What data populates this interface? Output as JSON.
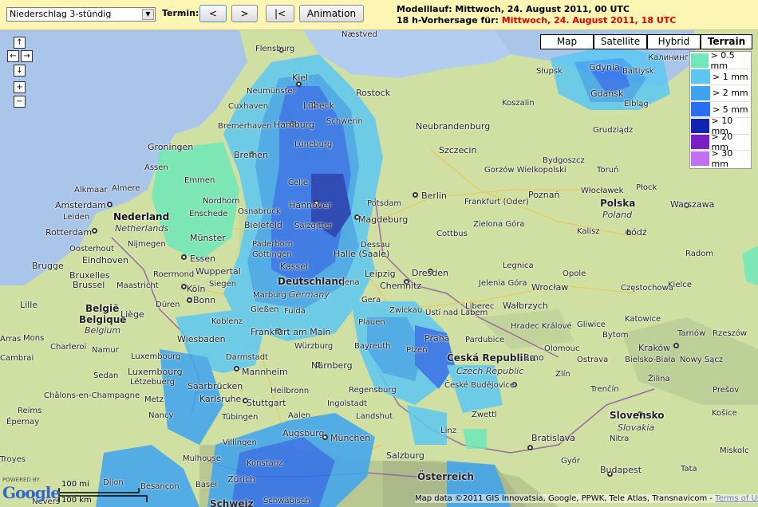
{
  "toolbar": {
    "product_selected": "Niederschlag 3-stündig",
    "termin_label": "Termin:",
    "prev_label": "<",
    "next_label": ">",
    "first_label": "|<",
    "animation_label": "Animation"
  },
  "header": {
    "model_run": "Modelllauf: Mittwoch, 24. August 2011, 00 UTC",
    "forecast_prefix": "18 h-Vorhersage für: ",
    "forecast_time": "Mittwoch, 24. August 2011, 18 UTC",
    "forecast_color": "#e00000"
  },
  "map_types": [
    {
      "label": "Map",
      "active": false
    },
    {
      "label": "Satellite",
      "active": false
    },
    {
      "label": "Hybrid",
      "active": false
    },
    {
      "label": "Terrain",
      "active": true
    }
  ],
  "nav": {
    "up": "↑",
    "left": "←",
    "right": "→",
    "down": "↓",
    "zoom_in": "+",
    "zoom_out": "−"
  },
  "legend": [
    {
      "label": "> 0.5 mm",
      "color": "#6ee8b8"
    },
    {
      "label": "> 1 mm",
      "color": "#5cc8f2"
    },
    {
      "label": "> 2 mm",
      "color": "#3ea4f0"
    },
    {
      "label": "> 5 mm",
      "color": "#2a6ef0"
    },
    {
      "label": "> 10 mm",
      "color": "#0f24b0"
    },
    {
      "label": "> 20 mm",
      "color": "#7a1ec8"
    },
    {
      "label": "> 30 mm",
      "color": "#c070f0"
    }
  ],
  "scale": {
    "miles": "100 mi",
    "km": "100 km"
  },
  "google": {
    "powered": "POWERED BY",
    "logo": "Google"
  },
  "attribution": {
    "text": "Map data ©2011 GIS Innovatsia, Google, PPWK, Tele Atlas, Transnavicom - ",
    "terms": "Terms of Use"
  },
  "places": [
    {
      "name": "Flensburg"
    },
    {
      "name": "Næstved"
    },
    {
      "name": "Kiel"
    },
    {
      "name": "Neumünster"
    },
    {
      "name": "Rostock"
    },
    {
      "name": "Lübeck"
    },
    {
      "name": "Cuxhaven"
    },
    {
      "name": "Hamburg"
    },
    {
      "name": "Schwerin"
    },
    {
      "name": "Bremerhaven"
    },
    {
      "name": "Neubrandenburg"
    },
    {
      "name": "Szczecin"
    },
    {
      "name": "Groningen"
    },
    {
      "name": "Lüneburg"
    },
    {
      "name": "Bremen"
    },
    {
      "name": "Assen"
    },
    {
      "name": "Emmen"
    },
    {
      "name": "Celle"
    },
    {
      "name": "Alkmaar"
    },
    {
      "name": "Almere"
    },
    {
      "name": "Amsterdam"
    },
    {
      "name": "Hannover"
    },
    {
      "name": "Potsdam"
    },
    {
      "name": "Berlin"
    },
    {
      "name": "Frankfurt (Oder)"
    },
    {
      "name": "Poznań"
    },
    {
      "name": "Leiden"
    },
    {
      "name": "Nederland"
    },
    {
      "name": "Netherlands"
    },
    {
      "name": "Nordhorn"
    },
    {
      "name": "Enschede"
    },
    {
      "name": "Osnabrück"
    },
    {
      "name": "Magdeburg"
    },
    {
      "name": "Zielona Góra"
    },
    {
      "name": "Rotterdam"
    },
    {
      "name": "Bielefeld"
    },
    {
      "name": "Salzgitter"
    },
    {
      "name": "Dessau"
    },
    {
      "name": "Cottbus"
    },
    {
      "name": "Nijmegen"
    },
    {
      "name": "Münster"
    },
    {
      "name": "Paderborn"
    },
    {
      "name": "Oosterhout"
    },
    {
      "name": "Göttingen"
    },
    {
      "name": "Halle (Saale)"
    },
    {
      "name": "Eindhoven"
    },
    {
      "name": "Essen"
    },
    {
      "name": "Kassel"
    },
    {
      "name": "Leipzig"
    },
    {
      "name": "Dresden"
    },
    {
      "name": "Legnica"
    },
    {
      "name": "Wrocław"
    },
    {
      "name": "Brugge"
    },
    {
      "name": "Bruxelles"
    },
    {
      "name": "Roermond"
    },
    {
      "name": "Wuppertal"
    },
    {
      "name": "Deutschland"
    },
    {
      "name": "Jena"
    },
    {
      "name": "Chemnitz"
    },
    {
      "name": "Jelenia Góra"
    },
    {
      "name": "Brussel"
    },
    {
      "name": "Maastricht"
    },
    {
      "name": "Köln"
    },
    {
      "name": "Siegen"
    },
    {
      "name": "Germany"
    },
    {
      "name": "Gera"
    },
    {
      "name": "Lille"
    },
    {
      "name": "België"
    },
    {
      "name": "Belgique"
    },
    {
      "name": "Belgium"
    },
    {
      "name": "Liège"
    },
    {
      "name": "Bonn"
    },
    {
      "name": "Marburg"
    },
    {
      "name": "Gießen"
    },
    {
      "name": "Fulda"
    },
    {
      "name": "Zwickau"
    },
    {
      "name": "Liberec"
    },
    {
      "name": "Wałbrzych"
    },
    {
      "name": "Düren"
    },
    {
      "name": "Ústí nad Labem"
    },
    {
      "name": "Koblenz"
    },
    {
      "name": "Plauen"
    },
    {
      "name": "Hradec Králové"
    },
    {
      "name": "Pardubice"
    },
    {
      "name": "Frankfurt am Main"
    },
    {
      "name": "Wiesbaden"
    },
    {
      "name": "Würzburg"
    },
    {
      "name": "Bayreuth"
    },
    {
      "name": "Plzeň"
    },
    {
      "name": "Praha"
    },
    {
      "name": "Luxembourg"
    },
    {
      "name": "Darmstadt"
    },
    {
      "name": "Mannheim"
    },
    {
      "name": "Nürnberg"
    },
    {
      "name": "Česká Republika"
    },
    {
      "name": "Czech Republic"
    },
    {
      "name": "Brno"
    },
    {
      "name": "Luxembourg"
    },
    {
      "name": "Lëtzebuerg"
    },
    {
      "name": "Saarbrücken"
    },
    {
      "name": "Heilbronn"
    },
    {
      "name": "Regensburg"
    },
    {
      "name": "České Budějovice"
    },
    {
      "name": "Metz"
    },
    {
      "name": "Karlsruhe"
    },
    {
      "name": "Stuttgart"
    },
    {
      "name": "Ingolstadt"
    },
    {
      "name": "Zwettl"
    },
    {
      "name": "Nancy"
    },
    {
      "name": "Tübingen"
    },
    {
      "name": "Aalen"
    },
    {
      "name": "Landshut"
    },
    {
      "name": "Augsburg"
    },
    {
      "name": "München"
    },
    {
      "name": "Linz"
    },
    {
      "name": "Bratislava"
    },
    {
      "name": "Villingen"
    },
    {
      "name": "Mulhouse"
    },
    {
      "name": "Salzburg"
    },
    {
      "name": "Konstanz"
    },
    {
      "name": "Dijon"
    },
    {
      "name": "Besançon"
    },
    {
      "name": "Zürich"
    },
    {
      "name": "Basel"
    },
    {
      "name": "Österreich"
    },
    {
      "name": "Schweiz"
    },
    {
      "name": "Bydgoszcz"
    },
    {
      "name": "Toruń"
    },
    {
      "name": "Gorzów Wielkopolski"
    },
    {
      "name": "Włocławek"
    },
    {
      "name": "Płock"
    },
    {
      "name": "Polska"
    },
    {
      "name": "Poland"
    },
    {
      "name": "Warszawa"
    },
    {
      "name": "Kalisz"
    },
    {
      "name": "Łódź"
    },
    {
      "name": "Radom"
    },
    {
      "name": "Opole"
    },
    {
      "name": "Częstochowa"
    },
    {
      "name": "Kielce"
    },
    {
      "name": "Katowice"
    },
    {
      "name": "Gliwice"
    },
    {
      "name": "Bytom"
    },
    {
      "name": "Ostrava"
    },
    {
      "name": "Kraków"
    },
    {
      "name": "Tarnów"
    },
    {
      "name": "Rzeszów"
    },
    {
      "name": "Olomouc"
    },
    {
      "name": "Zlín"
    },
    {
      "name": "Bielsko-Biała"
    },
    {
      "name": "Nowy Sącz"
    },
    {
      "name": "Trenčín"
    },
    {
      "name": "Žilina"
    },
    {
      "name": "Prešov"
    },
    {
      "name": "Košice"
    },
    {
      "name": "Slovensko"
    },
    {
      "name": "Slovakia"
    },
    {
      "name": "Nitra"
    },
    {
      "name": "Miskolc"
    },
    {
      "name": "Győr"
    },
    {
      "name": "Budapest"
    },
    {
      "name": "Koszalin"
    },
    {
      "name": "Słupsk"
    },
    {
      "name": "Gdynia"
    },
    {
      "name": "Gdańsk"
    },
    {
      "name": "Elbląg"
    },
    {
      "name": "Grudziądz"
    },
    {
      "name": "Калининград"
    },
    {
      "name": "Baltiysk"
    },
    {
      "name": "Mons"
    },
    {
      "name": "Namur"
    },
    {
      "name": "Charleroi"
    },
    {
      "name": "Reims"
    },
    {
      "name": "Épernay"
    },
    {
      "name": "Châlons-en-Champagne"
    },
    {
      "name": "Arras"
    },
    {
      "name": "Cambrai"
    },
    {
      "name": "Troyes"
    },
    {
      "name": "Sedan"
    },
    {
      "name": "Nevers"
    },
    {
      "name": "Schwäbisch"
    },
    {
      "name": "Tata"
    }
  ]
}
